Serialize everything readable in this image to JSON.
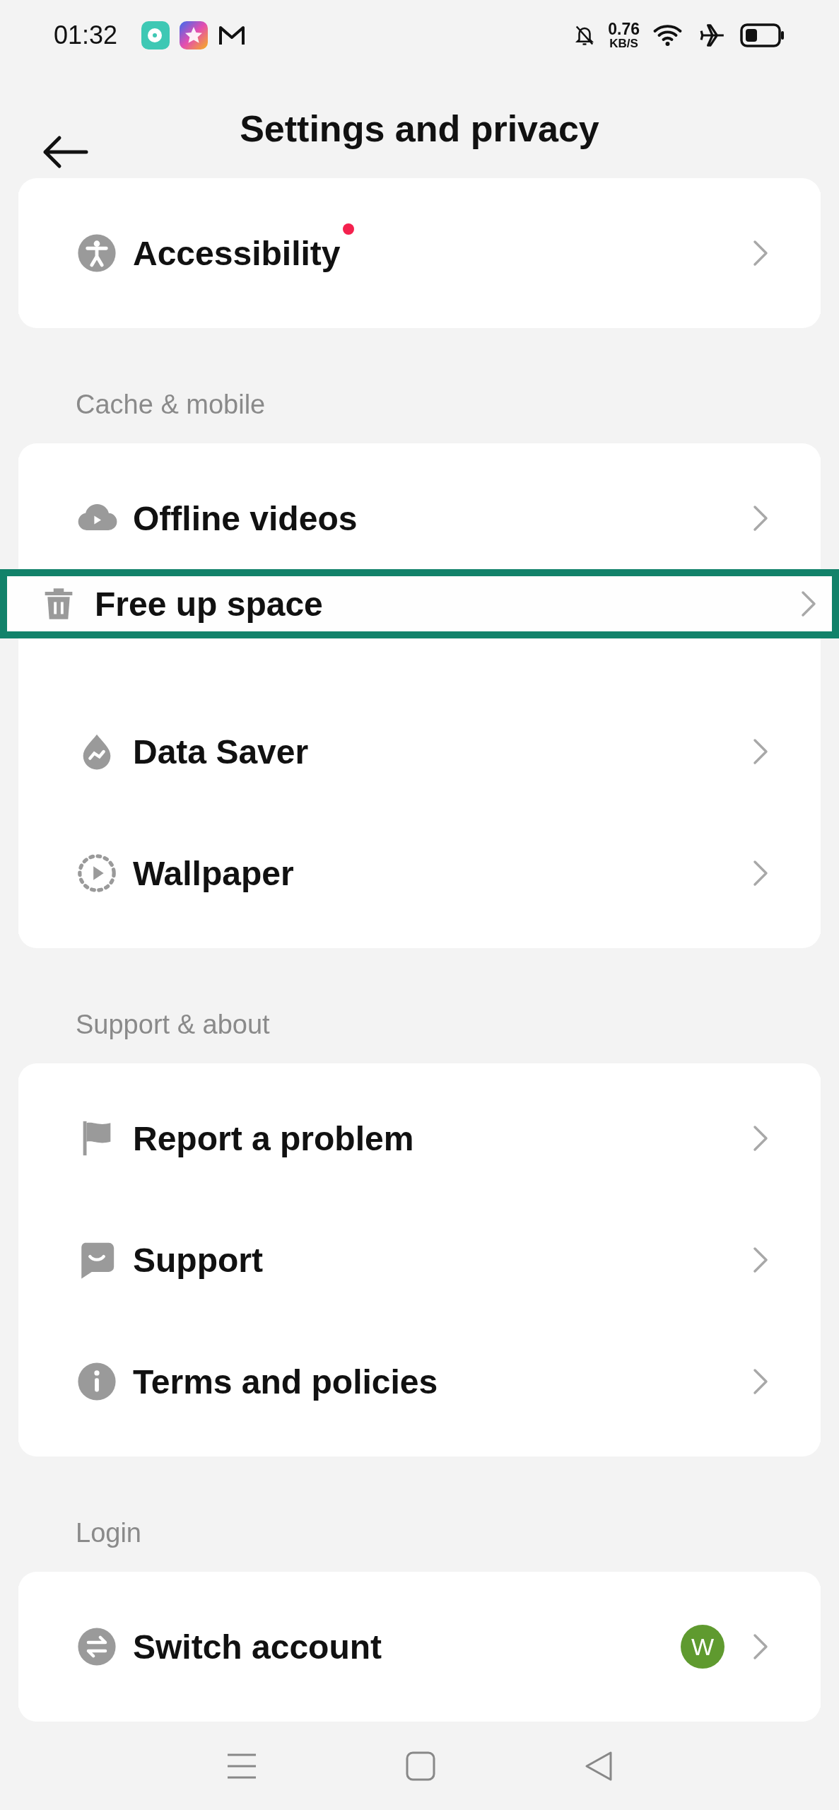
{
  "status_bar": {
    "time": "01:32",
    "speed": "0.76",
    "speed_unit": "KB/S"
  },
  "header": {
    "title": "Settings and privacy"
  },
  "sections": [
    {
      "items": [
        {
          "kind": "accessibility",
          "label": "Accessibility",
          "dot": true,
          "highlighted": false
        }
      ]
    },
    {
      "heading": "Cache & mobile",
      "items": [
        {
          "kind": "offline",
          "label": "Offline videos",
          "dot": false,
          "highlighted": false
        },
        {
          "kind": "trash",
          "label": "Free up space",
          "dot": false,
          "highlighted": true
        },
        {
          "kind": "datasaver",
          "label": "Data Saver",
          "dot": false,
          "highlighted": false
        },
        {
          "kind": "wallpaper",
          "label": "Wallpaper",
          "dot": false,
          "highlighted": false
        }
      ]
    },
    {
      "heading": "Support & about",
      "items": [
        {
          "kind": "flag",
          "label": "Report a problem",
          "dot": false,
          "highlighted": false
        },
        {
          "kind": "support",
          "label": "Support",
          "dot": false,
          "highlighted": false
        },
        {
          "kind": "info",
          "label": "Terms and policies",
          "dot": false,
          "highlighted": false
        }
      ]
    },
    {
      "heading": "Login",
      "items": [
        {
          "kind": "switch",
          "label": "Switch account",
          "dot": false,
          "highlighted": false,
          "avatar": "W"
        }
      ]
    }
  ]
}
